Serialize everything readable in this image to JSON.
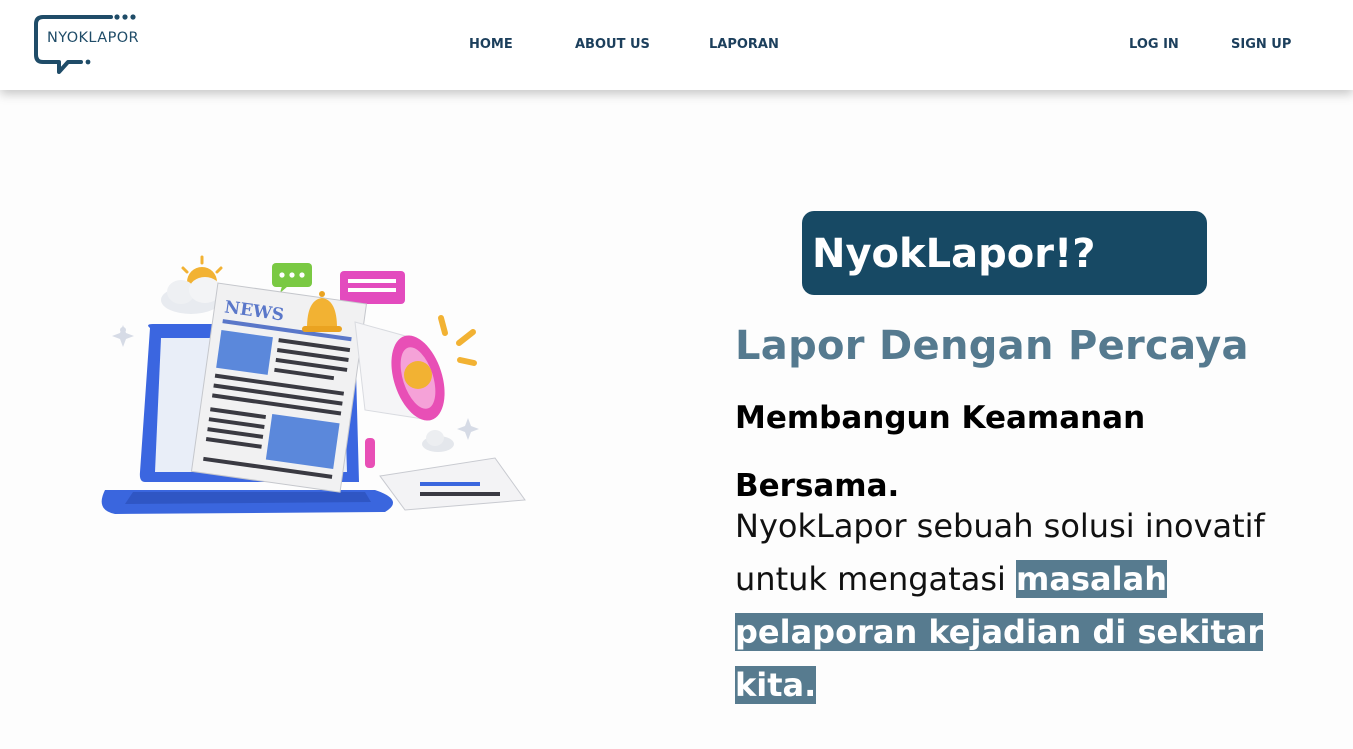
{
  "header": {
    "logo_text": "NYOKLAPOR",
    "nav": {
      "home": "HOME",
      "about": "ABOUT US",
      "laporan": "LAPORAN"
    },
    "auth": {
      "login": "LOG IN",
      "signup": "SIGN UP"
    }
  },
  "hero": {
    "brand": "NyokLapor!?",
    "tagline": "Lapor Dengan Percaya",
    "subtitle_line1": "Membangun Keamanan",
    "subtitle_line2": "Bersama.",
    "description_plain": "NyokLapor sebuah solusi inovatif untuk mengatasi",
    "description_highlight": "masalah pelaporan kejadian di sekitar kita."
  },
  "illustration": {
    "newspaper_label": "NEWS"
  },
  "colors": {
    "navy": "#174964",
    "steel": "#557a8f",
    "highlight": "#577b8f",
    "nav_text": "#1c3f5c"
  }
}
